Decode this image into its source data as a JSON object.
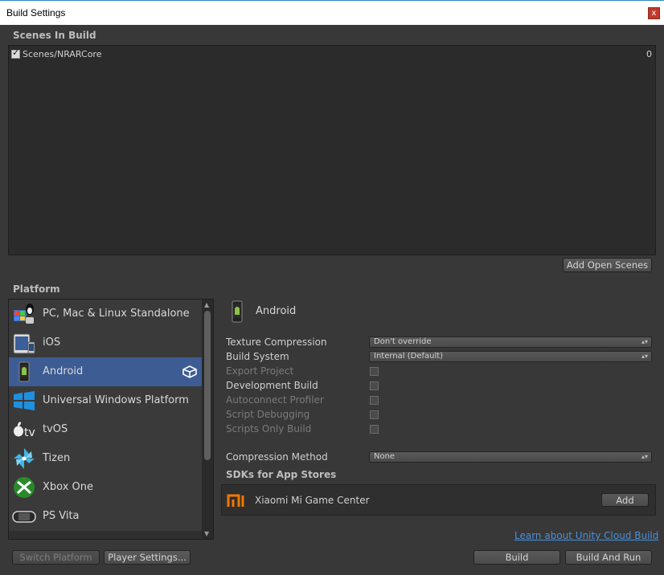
{
  "window": {
    "title": "Build Settings",
    "close_label": "x"
  },
  "scenes": {
    "header": "Scenes In Build",
    "items": [
      {
        "name": "Scenes/NRARCore",
        "index": "0",
        "checked": true
      }
    ],
    "add_open_scenes_label": "Add Open Scenes"
  },
  "platform": {
    "header": "Platform",
    "items": [
      {
        "label": "PC, Mac & Linux Standalone",
        "icon": "pc-mac-linux-icon"
      },
      {
        "label": "iOS",
        "icon": "ios-devices-icon"
      },
      {
        "label": "Android",
        "icon": "android-phone-icon",
        "selected": true
      },
      {
        "label": "Universal Windows Platform",
        "icon": "windows-icon"
      },
      {
        "label": "tvOS",
        "icon": "apple-tv-icon"
      },
      {
        "label": "Tizen",
        "icon": "tizen-icon"
      },
      {
        "label": "Xbox One",
        "icon": "xbox-icon"
      },
      {
        "label": "PS Vita",
        "icon": "ps-vita-icon"
      }
    ],
    "switch_platform_label": "Switch Platform",
    "player_settings_label": "Player Settings..."
  },
  "settings": {
    "platform_title": "Android",
    "texture_compression": {
      "label": "Texture Compression",
      "value": "Don't override"
    },
    "build_system": {
      "label": "Build System",
      "value": "Internal (Default)"
    },
    "export_project": {
      "label": "Export Project"
    },
    "development_build": {
      "label": "Development Build"
    },
    "autoconnect_profiler": {
      "label": "Autoconnect Profiler"
    },
    "script_debugging": {
      "label": "Script Debugging"
    },
    "scripts_only_build": {
      "label": "Scripts Only Build"
    },
    "compression_method": {
      "label": "Compression Method",
      "value": "None"
    },
    "sdks_header": "SDKs for App Stores",
    "sdk_item": {
      "name": "Xiaomi Mi Game Center",
      "add_label": "Add"
    },
    "cloud_build_link": "Learn about Unity Cloud Build",
    "build_label": "Build",
    "build_and_run_label": "Build And Run"
  },
  "colors": {
    "background": "#383838",
    "selected": "#3d5c93",
    "link": "#4a90d9"
  }
}
